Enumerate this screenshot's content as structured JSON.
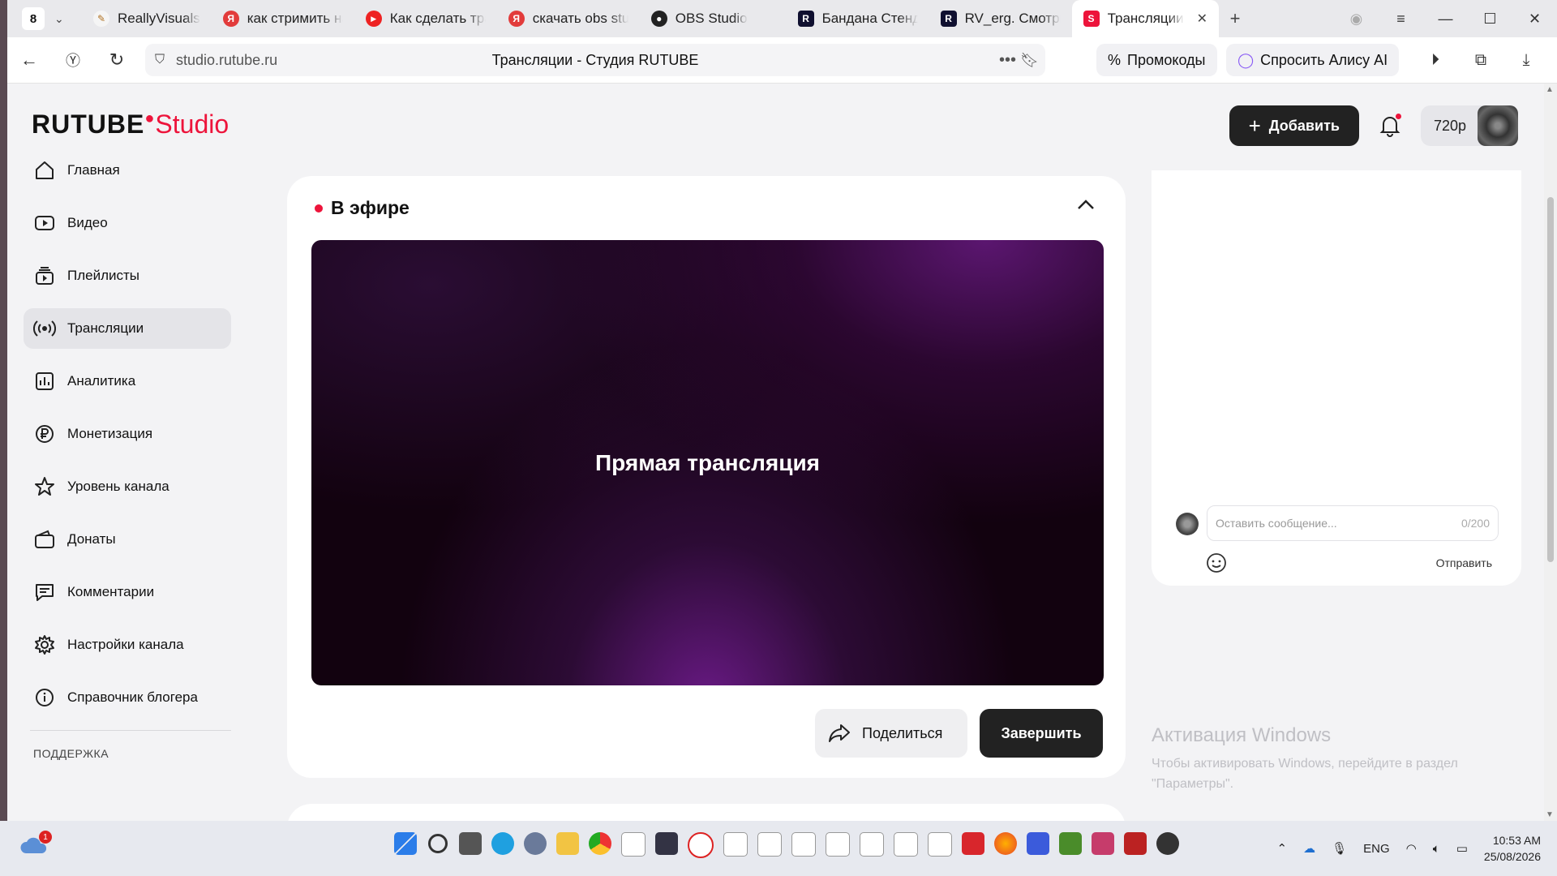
{
  "browser": {
    "tab_count": "8",
    "tabs": [
      {
        "label": "ReallyVisuals",
        "icon": "reallyvisuals-favicon",
        "color": "#b07020"
      },
      {
        "label": "как стримить на",
        "icon": "yandex-favicon",
        "color": "#e23b3b"
      },
      {
        "label": "Как сделать тра",
        "icon": "youtube-favicon",
        "color": "#e22"
      },
      {
        "label": "скачать obs stuc",
        "icon": "yandex-favicon",
        "color": "#e23b3b"
      },
      {
        "label": "OBS Studio",
        "icon": "obs-favicon",
        "color": "#222"
      },
      {
        "label": "Бандана Стендо",
        "icon": "rutube-favicon",
        "color": "#101030"
      },
      {
        "label": "RV_erg. Смотри",
        "icon": "rutube-favicon",
        "color": "#101030"
      },
      {
        "label": "Трансляции",
        "icon": "rutube-studio-favicon",
        "color": "#ed143b"
      }
    ],
    "url_host": "studio.rutube.ru",
    "page_title": "Трансляции - Студия RUTUBE",
    "promo_label": "Промокоды",
    "alice_label": "Спросить Алису AI"
  },
  "logo": {
    "brand": "RUTUBE",
    "product": "Studio"
  },
  "sidebar": {
    "items": [
      {
        "label": "Главная",
        "icon": "home-icon"
      },
      {
        "label": "Видео",
        "icon": "video-icon"
      },
      {
        "label": "Плейлисты",
        "icon": "playlist-icon"
      },
      {
        "label": "Трансляции",
        "icon": "broadcast-icon",
        "active": true
      },
      {
        "label": "Аналитика",
        "icon": "analytics-icon"
      },
      {
        "label": "Монетизация",
        "icon": "ruble-icon"
      },
      {
        "label": "Уровень канала",
        "icon": "star-icon"
      },
      {
        "label": "Донаты",
        "icon": "wallet-icon"
      },
      {
        "label": "Комментарии",
        "icon": "comment-icon"
      },
      {
        "label": "Настройки канала",
        "icon": "gear-icon"
      },
      {
        "label": "Справочник блогера",
        "icon": "info-icon"
      }
    ],
    "support_label": "ПОДДЕРЖКА"
  },
  "header": {
    "add_label": "Добавить",
    "quality": "720p"
  },
  "live": {
    "status": "В эфире",
    "player_text": "Прямая трансляция",
    "share_label": "Поделиться",
    "finish_label": "Завершить"
  },
  "chat": {
    "placeholder": "Оставить сообщение...",
    "counter": "0/200",
    "send_label": "Отправить"
  },
  "activation": {
    "title": "Активация Windows",
    "text": "Чтобы активировать Windows, перейдите в раздел \"Параметры\"."
  },
  "taskbar": {
    "weather_badge": "1",
    "lang": "ENG",
    "time": "10:53 AM",
    "date": "25/08/2026"
  },
  "colors": {
    "accent": "#ed143b",
    "dark_button": "#222222"
  }
}
